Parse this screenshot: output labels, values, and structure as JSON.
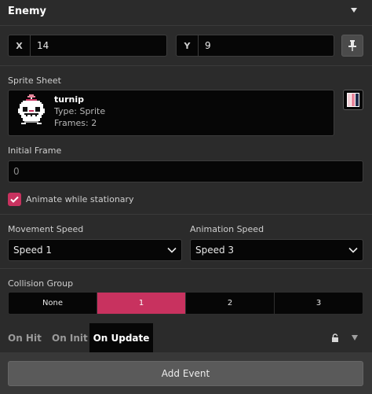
{
  "header": {
    "title": "Enemy",
    "collapse_icon": "triangle-down-icon"
  },
  "coordinates": {
    "x_label": "X",
    "x_value": "14",
    "y_label": "Y",
    "y_value": "9",
    "pin_icon": "pin-icon"
  },
  "sprite_sheet": {
    "label": "Sprite Sheet",
    "name": "turnip",
    "type_text": "Type:  Sprite",
    "frames_text": "Frames:  2",
    "palette_icon": "palette-icon"
  },
  "initial_frame": {
    "label": "Initial Frame",
    "placeholder": "0"
  },
  "animate_checkbox": {
    "label": "Animate while stationary",
    "checked": true
  },
  "movement_speed": {
    "label": "Movement Speed",
    "value": "Speed 1"
  },
  "animation_speed": {
    "label": "Animation Speed",
    "value": "Speed 3"
  },
  "collision_group": {
    "label": "Collision Group",
    "options": [
      "None",
      "1",
      "2",
      "3"
    ],
    "selected": "1"
  },
  "tabs": {
    "on_hit": "On Hit",
    "on_init": "On Init",
    "on_update": "On Update",
    "active": "On Update"
  },
  "add_event": {
    "label": "Add Event"
  },
  "colors": {
    "accent": "#c8325f",
    "background": "#2b2b2b",
    "field": "#060606"
  }
}
